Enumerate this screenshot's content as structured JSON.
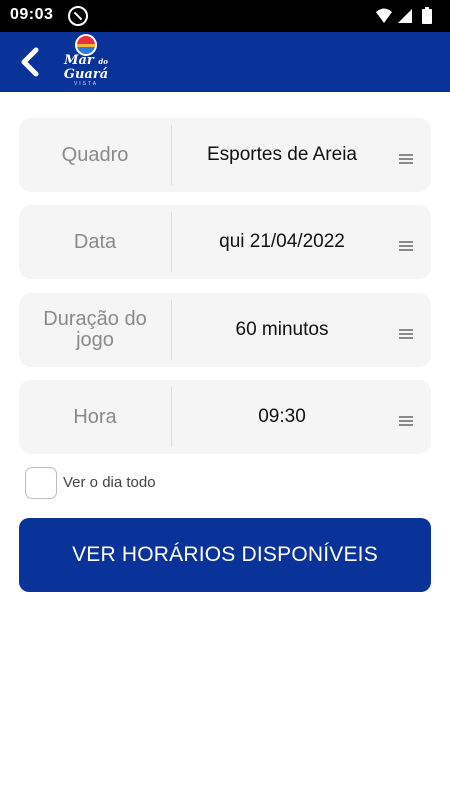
{
  "status_bar": {
    "time": "09:03",
    "icons": [
      "notification-app-icon",
      "wifi-icon",
      "signal-icon",
      "battery-icon"
    ]
  },
  "app_bar": {
    "back_icon": "chevron-left-icon",
    "logo_text_line1": "Mar",
    "logo_text_line2": "Guará",
    "logo_small": "do",
    "logo_sub": "VISTA",
    "color": "#0a3399"
  },
  "fields": [
    {
      "label": "Quadro",
      "value": "Esportes de Areia",
      "icon": "menu-lines-icon"
    },
    {
      "label": "Data",
      "value": "qui 21/04/2022",
      "icon": "menu-lines-icon"
    },
    {
      "label": "Duração do jogo",
      "value": "60 minutos",
      "icon": "menu-lines-icon"
    },
    {
      "label": "Hora",
      "value": "09:30",
      "icon": "menu-lines-icon"
    }
  ],
  "day_checkbox": {
    "label": "Ver o dia todo",
    "checked": false
  },
  "submit_button": {
    "label": "VER HORÁRIOS DISPONÍVEIS",
    "color": "#0a3399"
  }
}
